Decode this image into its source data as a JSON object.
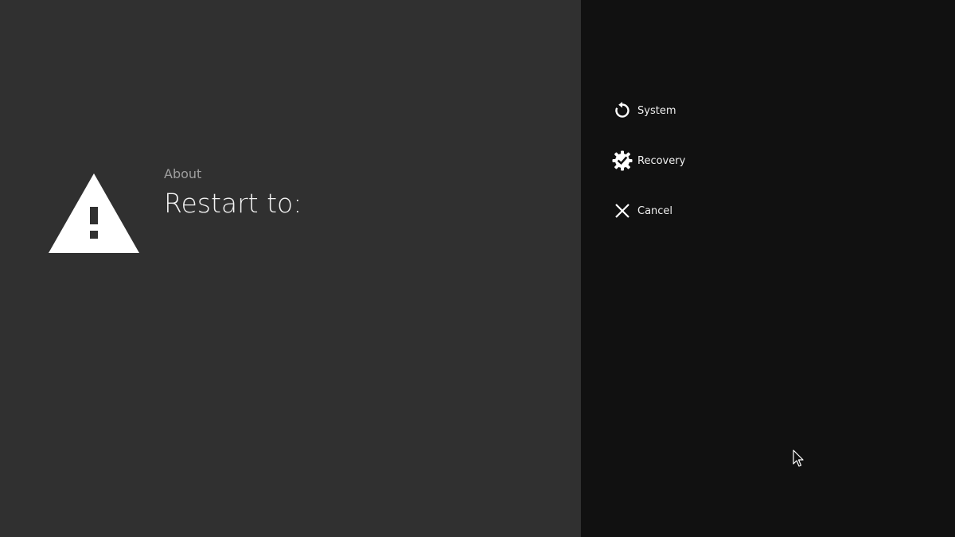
{
  "header": {
    "breadcrumb": "About",
    "title": "Restart to:",
    "icon": "warning-triangle-icon"
  },
  "menu": {
    "items": [
      {
        "label": "System",
        "icon": "restart-icon"
      },
      {
        "label": "Recovery",
        "icon": "settings-gear-check-icon"
      },
      {
        "label": "Cancel",
        "icon": "close-icon"
      }
    ]
  },
  "colors": {
    "left_panel_bg": "#303030",
    "right_panel_bg": "#111111",
    "text_primary": "#f2f2f2",
    "text_secondary": "#9e9e9e"
  }
}
